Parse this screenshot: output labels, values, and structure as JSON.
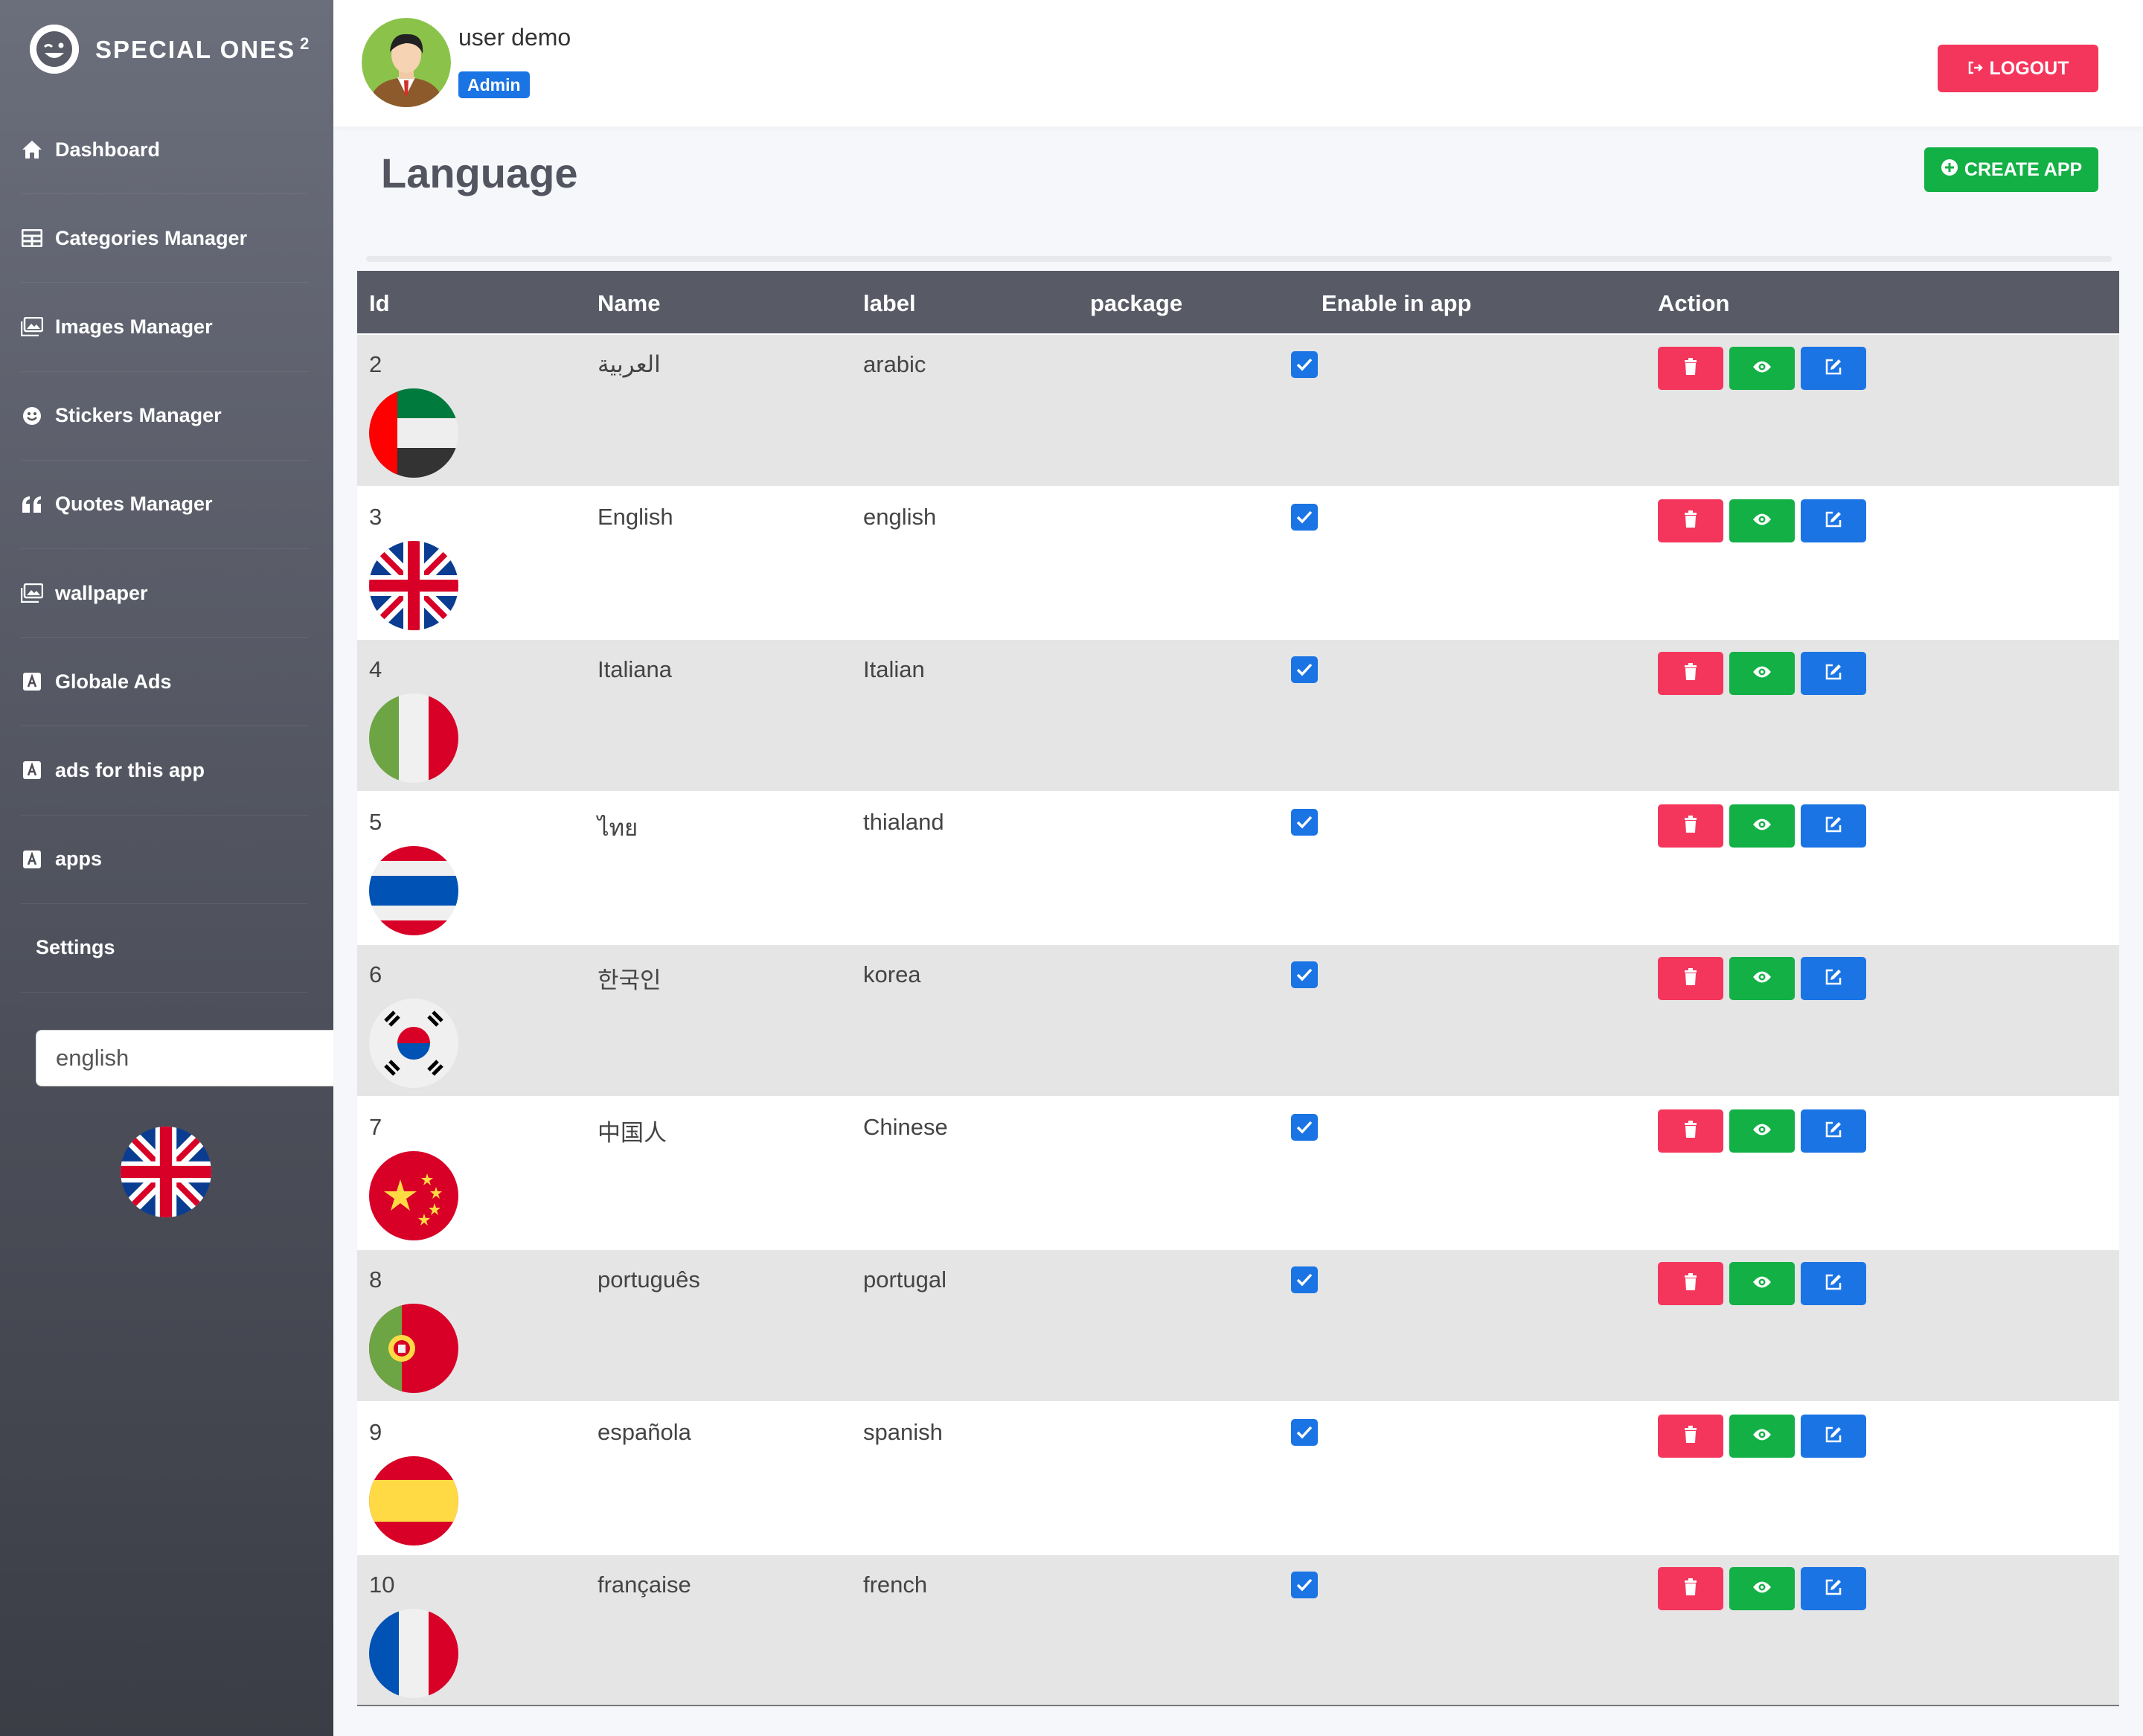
{
  "app": {
    "brand": "SPECIAL ONES",
    "brand_sup": "2"
  },
  "user": {
    "name": "user demo",
    "role": "Admin"
  },
  "header": {
    "logout_label": "LOGOUT"
  },
  "page": {
    "title": "Language",
    "create_label": "CREATE APP"
  },
  "sidebar": {
    "items": [
      {
        "label": "Dashboard",
        "icon": "home-icon"
      },
      {
        "label": "Categories Manager",
        "icon": "table-icon"
      },
      {
        "label": "Images Manager",
        "icon": "images-icon"
      },
      {
        "label": "Stickers Manager",
        "icon": "smile-icon"
      },
      {
        "label": "Quotes Manager",
        "icon": "quote-icon"
      },
      {
        "label": "wallpaper",
        "icon": "images-icon"
      },
      {
        "label": "Globale Ads",
        "icon": "ad-icon"
      },
      {
        "label": "ads for this app",
        "icon": "ad-icon"
      },
      {
        "label": "apps",
        "icon": "ad-icon"
      },
      {
        "label": "Settings",
        "icon": ""
      }
    ],
    "language_value": "english",
    "language_flag": "uk"
  },
  "table": {
    "columns": [
      "Id",
      "Name",
      "label",
      "package",
      "Enable in app",
      "Action"
    ],
    "rows": [
      {
        "id": "2",
        "name": "العربية",
        "label": "arabic",
        "flag": "uae",
        "enabled": true
      },
      {
        "id": "3",
        "name": "English",
        "label": "english",
        "flag": "uk",
        "enabled": true
      },
      {
        "id": "4",
        "name": "Italiana",
        "label": "Italian",
        "flag": "italy",
        "enabled": true
      },
      {
        "id": "5",
        "name": "ไทย",
        "label": "thialand",
        "flag": "thailand",
        "enabled": true
      },
      {
        "id": "6",
        "name": "한국인",
        "label": "korea",
        "flag": "korea",
        "enabled": true
      },
      {
        "id": "7",
        "name": "中国人",
        "label": "Chinese",
        "flag": "china",
        "enabled": true
      },
      {
        "id": "8",
        "name": "português",
        "label": "portugal",
        "flag": "portugal",
        "enabled": true
      },
      {
        "id": "9",
        "name": "española",
        "label": "spanish",
        "flag": "spain",
        "enabled": true
      },
      {
        "id": "10",
        "name": "française",
        "label": "french",
        "flag": "france",
        "enabled": true
      }
    ]
  },
  "colors": {
    "danger": "#f5365c",
    "success": "#13b045",
    "primary": "#1b74e4",
    "table_header": "#585b66"
  }
}
